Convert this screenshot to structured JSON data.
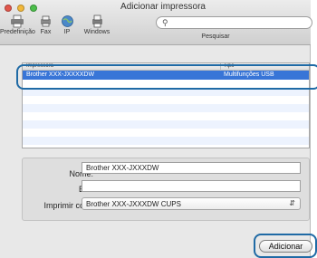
{
  "window": {
    "title": "Adicionar impressora"
  },
  "toolbar": {
    "items": [
      {
        "label": "Predefinição",
        "icon": "printer-default-icon"
      },
      {
        "label": "Fax",
        "icon": "fax-icon"
      },
      {
        "label": "IP",
        "icon": "globe-icon"
      },
      {
        "label": "Windows",
        "icon": "windows-printer-icon"
      }
    ],
    "search": {
      "label": "Pesquisar",
      "value": "",
      "icon": "magnifying-glass-icon"
    }
  },
  "printer_list": {
    "columns": [
      "Impressora",
      "Tipo"
    ],
    "rows": [
      {
        "name": "Brother XXX-JXXXXDW",
        "type": "Multifunções USB",
        "selected": true
      }
    ]
  },
  "form": {
    "name_label": "Nome:",
    "name_value": "Brother XXX-JXXXDW",
    "em_label": "Em:",
    "em_value": "",
    "print_with_label": "Imprimir com:",
    "print_with_value": "Brother XXX-JXXXDW CUPS"
  },
  "actions": {
    "add_label": "Adicionar"
  },
  "colors": {
    "selection": "#3875d7",
    "annotation": "#1f6aa5"
  }
}
